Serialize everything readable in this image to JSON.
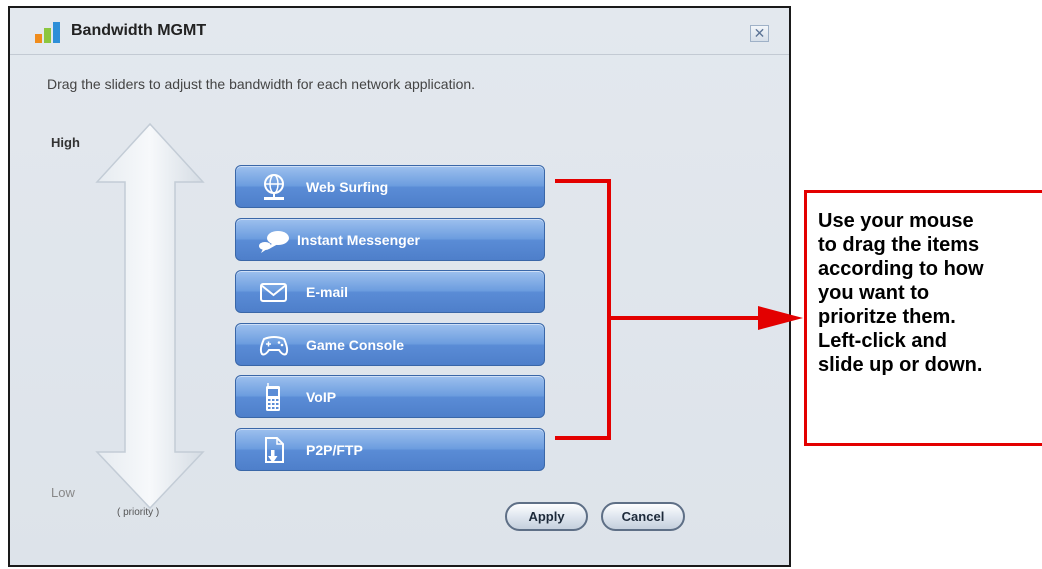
{
  "dialog": {
    "title": "Bandwidth MGMT",
    "close_symbol": "✕",
    "instruction": "Drag the sliders to adjust the bandwidth for each network application.",
    "priority_high": "High",
    "priority_low": "Low",
    "priority_caption": "( priority )",
    "apps": [
      {
        "label": "Web Surfing",
        "icon": "globe-icon"
      },
      {
        "label": "Instant Messenger",
        "icon": "chat-bubbles-icon"
      },
      {
        "label": "E-mail",
        "icon": "envelope-icon"
      },
      {
        "label": "Game Console",
        "icon": "gamepad-icon"
      },
      {
        "label": "VoIP",
        "icon": "phone-icon"
      },
      {
        "label": "P2P/FTP",
        "icon": "file-download-icon"
      }
    ],
    "apply_label": "Apply",
    "cancel_label": "Cancel"
  },
  "callout": {
    "text": "Use your mouse\nto drag the items\naccording to how\nyou want to\nprioritze them.\nLeft-click and\nslide up or down."
  },
  "colors": {
    "item_blue": "#5a8cd6",
    "annotation_red": "#e30000",
    "dialog_bg": "#e0e6ed"
  }
}
